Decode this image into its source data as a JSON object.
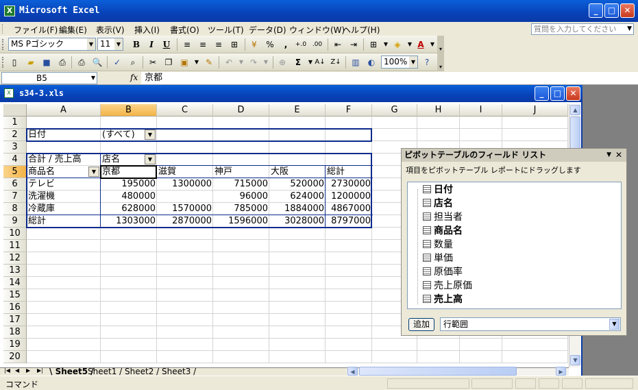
{
  "app": {
    "title": "Microsoft Excel"
  },
  "menu": {
    "items": [
      "ファイル(F)",
      "編集(E)",
      "表示(V)",
      "挿入(I)",
      "書式(O)",
      "ツール(T)",
      "データ(D)",
      "ウィンドウ(W)",
      "ヘルプ(H)"
    ],
    "help_placeholder": "質問を入力してください"
  },
  "toolbar": {
    "font_name": "MS Pゴシック",
    "font_size": "11",
    "bold": "B",
    "italic": "I",
    "underline": "U",
    "percent": "%",
    "comma": ",",
    "sigma": "Σ",
    "zoom": "100%"
  },
  "formula_bar": {
    "name_box": "B5",
    "fx": "fx",
    "value": "京都"
  },
  "workbook": {
    "title": "s34-3.xls"
  },
  "columns": [
    "A",
    "B",
    "C",
    "D",
    "E",
    "F",
    "G",
    "H",
    "I",
    "J"
  ],
  "rows": [
    "1",
    "2",
    "3",
    "4",
    "5",
    "6",
    "7",
    "8",
    "9",
    "10",
    "11",
    "12",
    "13",
    "14",
    "15",
    "16",
    "17",
    "18",
    "19",
    "20"
  ],
  "pivot": {
    "page_field_label": "日付",
    "page_field_value": "(すべて)",
    "data_label": "合計 / 売上高",
    "column_field": "店名",
    "row_field": "商品名",
    "column_items": [
      "京都",
      "滋賀",
      "神戸",
      "大阪",
      "総計"
    ],
    "rows": [
      {
        "label": "テレビ",
        "values": [
          "195000",
          "1300000",
          "715000",
          "520000",
          "2730000"
        ]
      },
      {
        "label": "洗濯機",
        "values": [
          "480000",
          "",
          "96000",
          "624000",
          "1200000"
        ]
      },
      {
        "label": "冷蔵庫",
        "values": [
          "628000",
          "1570000",
          "785000",
          "1884000",
          "4867000"
        ]
      },
      {
        "label": "総計",
        "values": [
          "1303000",
          "2870000",
          "1596000",
          "3028000",
          "8797000"
        ]
      }
    ]
  },
  "sheets": [
    "Sheet5",
    "Sheet1",
    "Sheet2",
    "Sheet3"
  ],
  "status": {
    "mode": "コマンド"
  },
  "field_list": {
    "title": "ピボットテーブルのフィールド リスト",
    "description": "項目をピボットテーブル レポートにドラッグします",
    "fields": [
      {
        "name": "日付",
        "bold": true
      },
      {
        "name": "店名",
        "bold": true
      },
      {
        "name": "担当者",
        "bold": false
      },
      {
        "name": "商品名",
        "bold": true
      },
      {
        "name": "数量",
        "bold": false
      },
      {
        "name": "単価",
        "bold": false
      },
      {
        "name": "原価率",
        "bold": false
      },
      {
        "name": "売上原価",
        "bold": false
      },
      {
        "name": "売上高",
        "bold": true
      }
    ],
    "add_button": "追加",
    "area_select": "行範囲"
  }
}
